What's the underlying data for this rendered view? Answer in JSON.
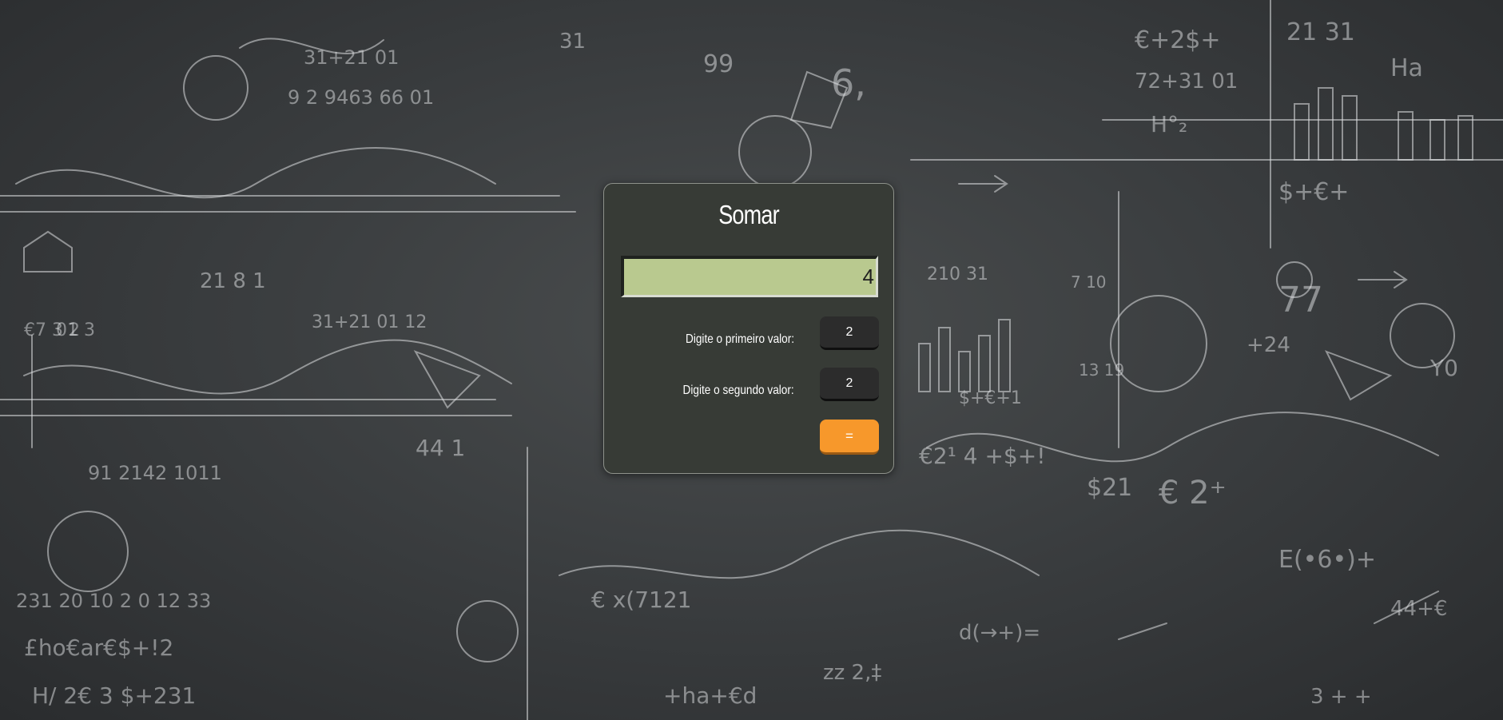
{
  "calculator": {
    "title": "Somar",
    "display_value": "4",
    "first_label": "Digite o primeiro valor:",
    "first_value": "2",
    "second_label": "Digite o segundo valor:",
    "second_value": "2",
    "equals_label": "="
  },
  "colors": {
    "panel_bg": "#373b36",
    "display_bg": "#b9c98f",
    "input_bg": "#2c2c2c",
    "button_accent": "#f7982b"
  }
}
